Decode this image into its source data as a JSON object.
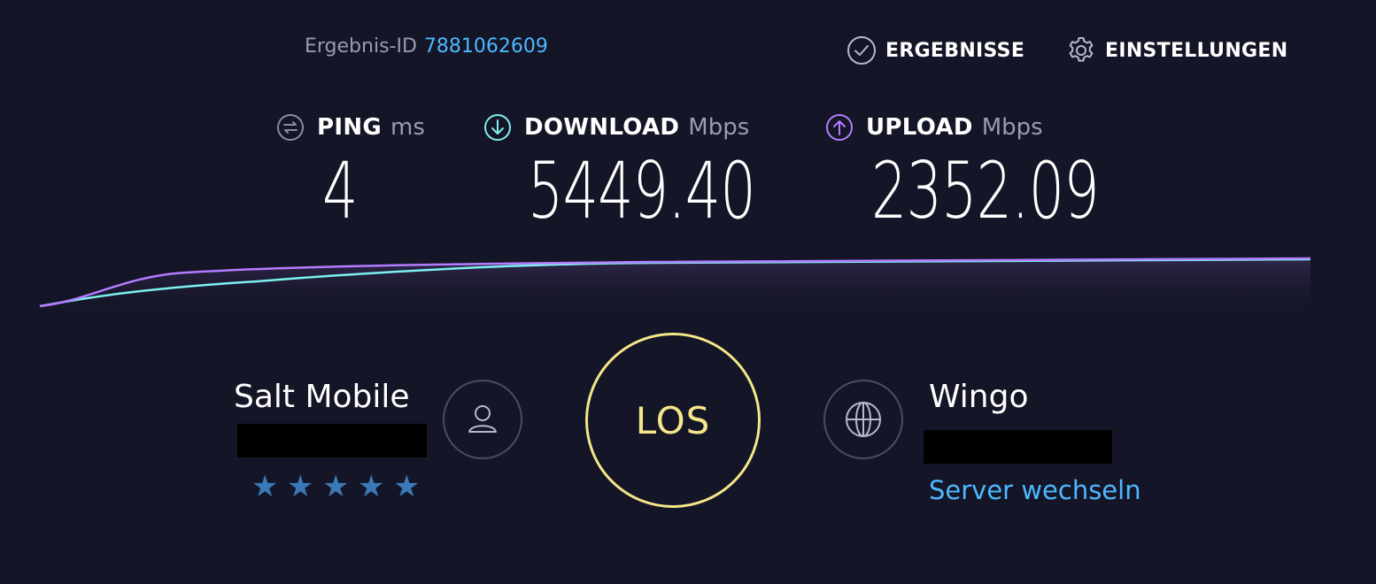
{
  "header": {
    "result_id_label": "Ergebnis-ID",
    "result_id_value": "7881062609",
    "results_label": "ERGEBNISSE",
    "settings_label": "EINSTELLUNGEN"
  },
  "metrics": {
    "ping": {
      "label": "PING",
      "unit": "ms",
      "value": "4",
      "icon": "ping-icon"
    },
    "download": {
      "label": "DOWNLOAD",
      "unit": "Mbps",
      "value": "5449.40",
      "icon": "download-arrow-icon"
    },
    "upload": {
      "label": "UPLOAD",
      "unit": "Mbps",
      "value": "2352.09",
      "icon": "upload-arrow-icon"
    }
  },
  "provider": {
    "name": "Salt Mobile",
    "rating_stars": 5,
    "star_glyph": "★",
    "icon": "user-icon"
  },
  "go_button": {
    "label": "LOS"
  },
  "server": {
    "name": "Wingo",
    "change_label": "Server wechseln",
    "icon": "globe-icon"
  },
  "colors": {
    "background": "#141526",
    "accent_blue": "#4db8ff",
    "download_line": "#7ef0f0",
    "upload_line": "#b47cff",
    "go_button": "#f5e68a",
    "star": "#3a79b8"
  }
}
